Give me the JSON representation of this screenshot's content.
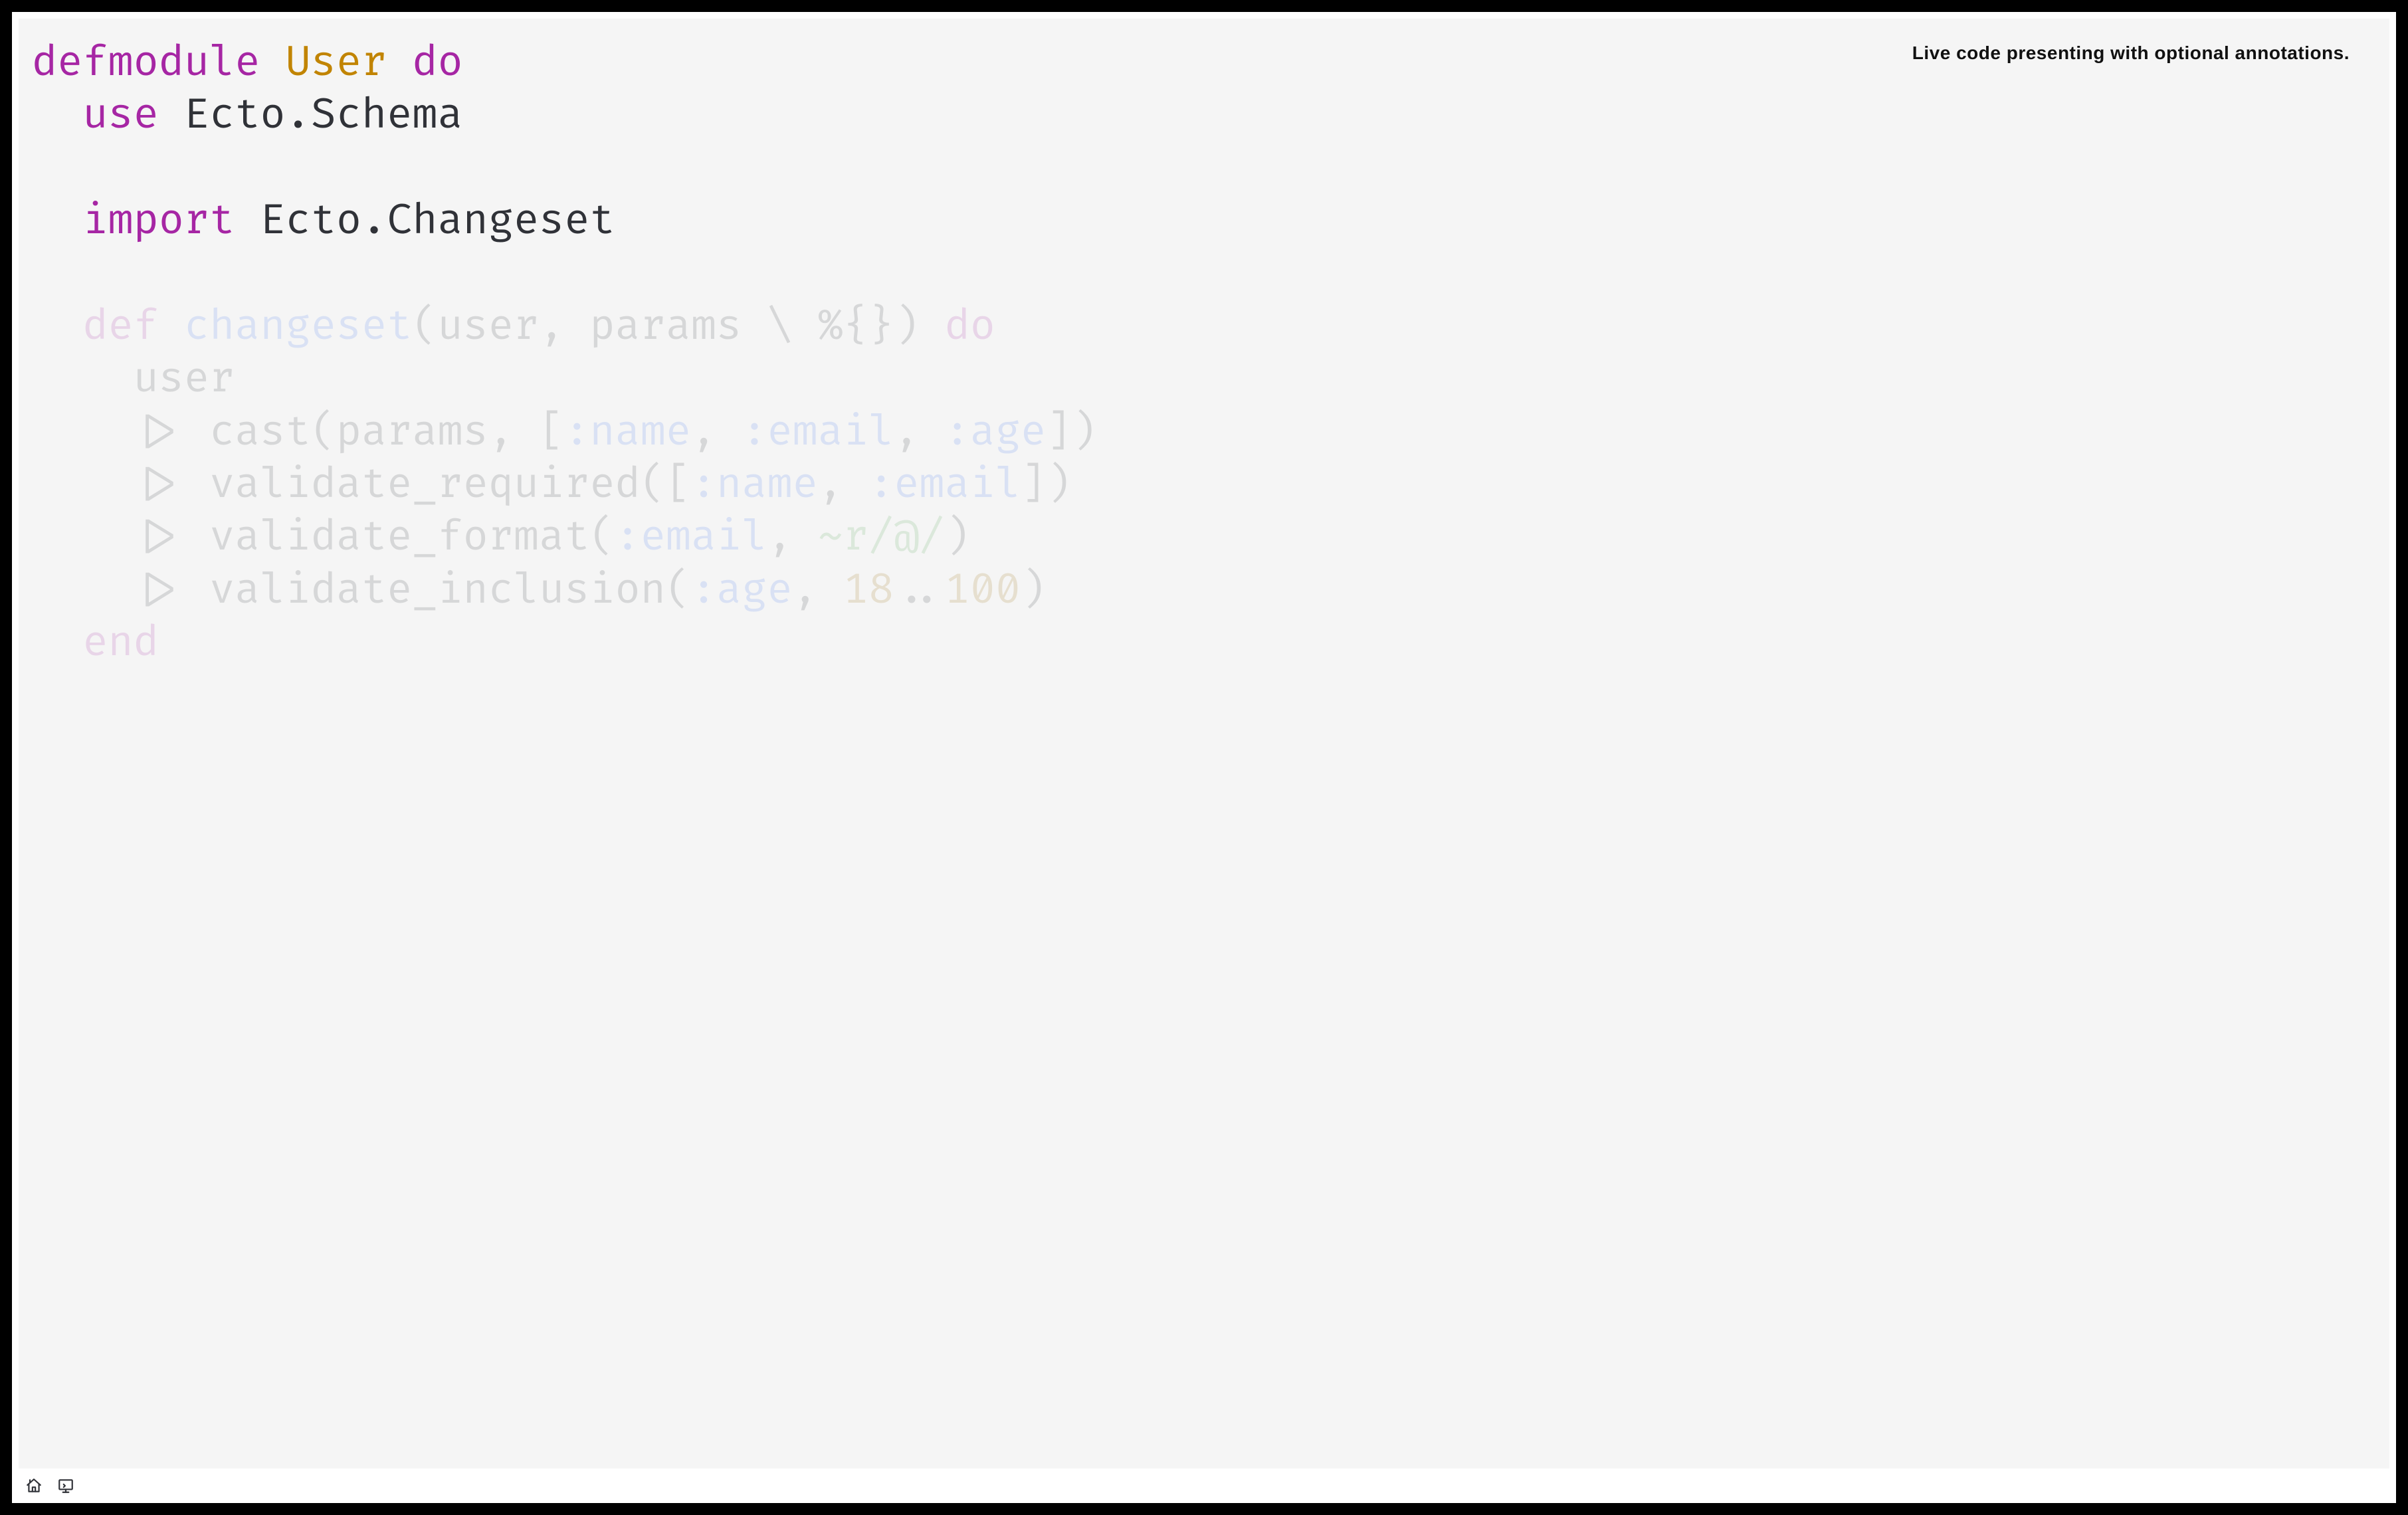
{
  "annotation": "Live code presenting with optional annotations.",
  "code": {
    "lines": [
      {
        "dim": false,
        "tokens": [
          {
            "cls": "kw",
            "t": "defmodule"
          },
          {
            "cls": "txt",
            "t": " "
          },
          {
            "cls": "mod",
            "t": "User"
          },
          {
            "cls": "txt",
            "t": " "
          },
          {
            "cls": "kw",
            "t": "do"
          }
        ]
      },
      {
        "dim": false,
        "tokens": [
          {
            "cls": "txt",
            "t": "  "
          },
          {
            "cls": "kw",
            "t": "use"
          },
          {
            "cls": "txt",
            "t": " Ecto.Schema"
          }
        ]
      },
      {
        "dim": false,
        "tokens": [
          {
            "cls": "txt",
            "t": ""
          }
        ]
      },
      {
        "dim": false,
        "tokens": [
          {
            "cls": "txt",
            "t": "  "
          },
          {
            "cls": "kw",
            "t": "import"
          },
          {
            "cls": "txt",
            "t": " Ecto.Changeset"
          }
        ]
      },
      {
        "dim": false,
        "tokens": [
          {
            "cls": "txt",
            "t": ""
          }
        ]
      },
      {
        "dim": true,
        "tokens": [
          {
            "cls": "txt",
            "t": "  "
          },
          {
            "cls": "kw",
            "t": "def"
          },
          {
            "cls": "txt",
            "t": " "
          },
          {
            "cls": "atom",
            "t": "changeset"
          },
          {
            "cls": "txt",
            "t": "(user, params \\\\ %{}) "
          },
          {
            "cls": "kw",
            "t": "do"
          }
        ]
      },
      {
        "dim": true,
        "tokens": [
          {
            "cls": "txt",
            "t": "    user"
          }
        ]
      },
      {
        "dim": true,
        "tokens": [
          {
            "cls": "txt",
            "t": "    |> cast(params, ["
          },
          {
            "cls": "atom",
            "t": ":name"
          },
          {
            "cls": "txt",
            "t": ", "
          },
          {
            "cls": "atom",
            "t": ":email"
          },
          {
            "cls": "txt",
            "t": ", "
          },
          {
            "cls": "atom",
            "t": ":age"
          },
          {
            "cls": "txt",
            "t": "])"
          }
        ]
      },
      {
        "dim": true,
        "tokens": [
          {
            "cls": "txt",
            "t": "    |> validate_required(["
          },
          {
            "cls": "atom",
            "t": ":name"
          },
          {
            "cls": "txt",
            "t": ", "
          },
          {
            "cls": "atom",
            "t": ":email"
          },
          {
            "cls": "txt",
            "t": "])"
          }
        ]
      },
      {
        "dim": true,
        "tokens": [
          {
            "cls": "txt",
            "t": "    |> validate_format("
          },
          {
            "cls": "atom",
            "t": ":email"
          },
          {
            "cls": "txt",
            "t": ", "
          },
          {
            "cls": "re",
            "t": "~r/@/"
          },
          {
            "cls": "txt",
            "t": ")"
          }
        ]
      },
      {
        "dim": true,
        "tokens": [
          {
            "cls": "txt",
            "t": "    |> validate_inclusion("
          },
          {
            "cls": "atom",
            "t": ":age"
          },
          {
            "cls": "txt",
            "t": ", "
          },
          {
            "cls": "num",
            "t": "18"
          },
          {
            "cls": "txt",
            "t": ".."
          },
          {
            "cls": "num",
            "t": "100"
          },
          {
            "cls": "txt",
            "t": ")"
          }
        ]
      },
      {
        "dim": true,
        "tokens": [
          {
            "cls": "txt",
            "t": "  "
          },
          {
            "cls": "kw",
            "t": "end"
          }
        ]
      }
    ]
  },
  "icons": {
    "home": "home-icon",
    "screen": "screen-icon"
  }
}
